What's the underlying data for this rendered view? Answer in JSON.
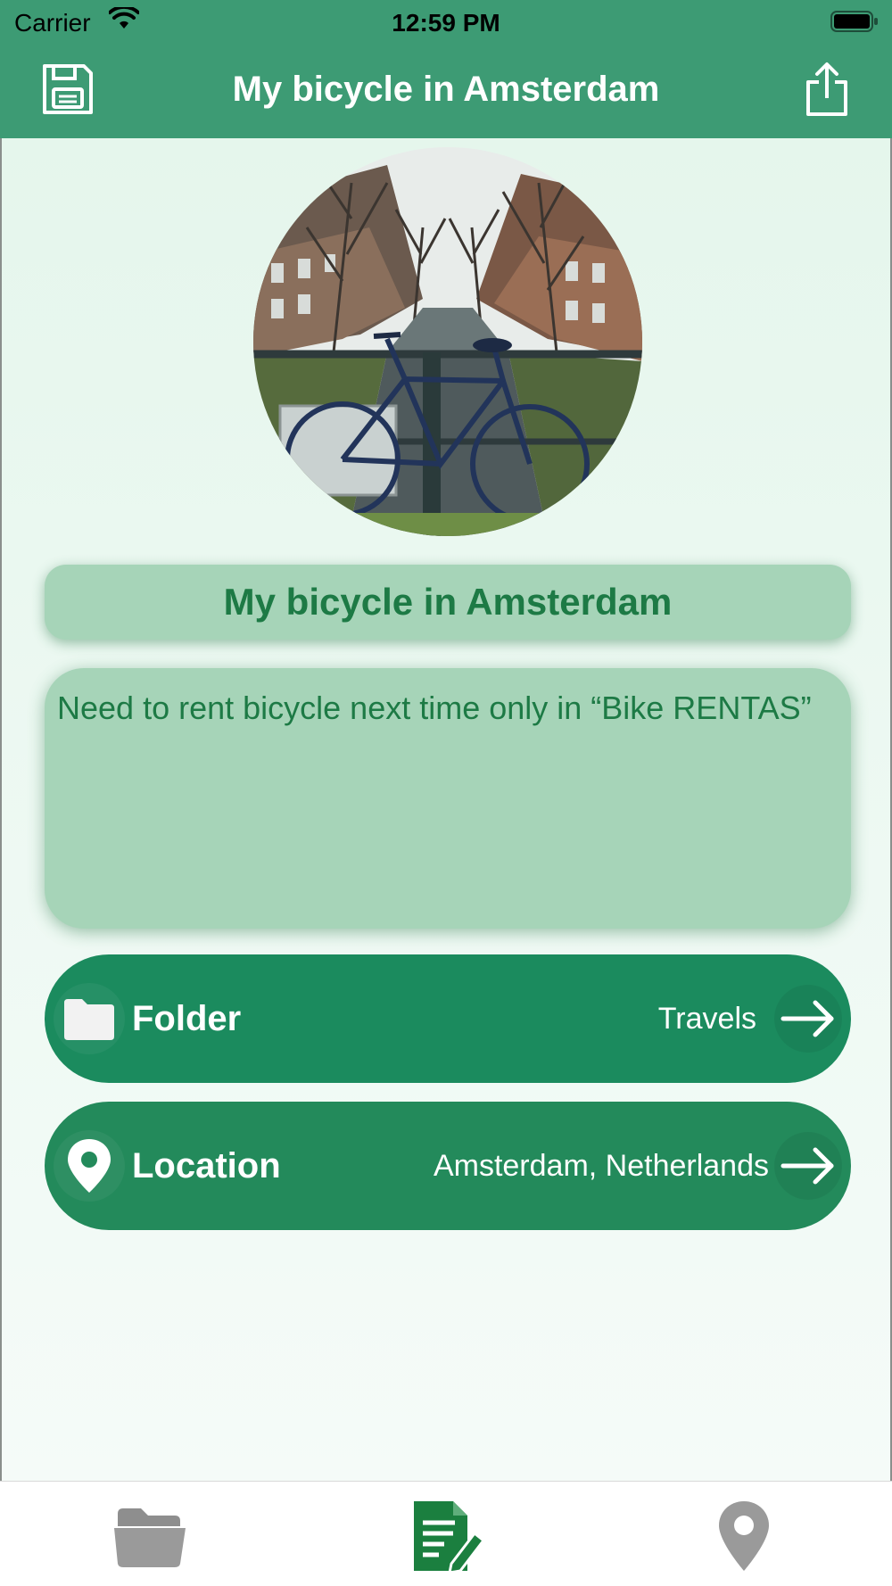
{
  "status_bar": {
    "carrier": "Carrier",
    "time": "12:59 PM"
  },
  "nav": {
    "title": "My bicycle in Amsterdam",
    "left_icon": "save-icon",
    "right_icon": "share-icon"
  },
  "note": {
    "title": "My bicycle in Amsterdam",
    "body": "Need to rent bicycle next time only in “Bike RENTAS”"
  },
  "folder_row": {
    "label": "Folder",
    "value": "Travels",
    "icon": "folder-icon"
  },
  "location_row": {
    "label": "Location",
    "value": "Amsterdam, Netherlands",
    "icon": "location-pin-icon"
  },
  "tab_bar": {
    "tabs": [
      {
        "icon": "folder-icon",
        "active": false
      },
      {
        "icon": "note-edit-icon",
        "active": true
      },
      {
        "icon": "location-pin-icon",
        "active": false
      }
    ]
  },
  "colors": {
    "header": "#3d9b74",
    "row_button": "#1b8b5e",
    "field": "#a6d4b8",
    "field_text": "#1d7a45",
    "tab_active": "#1b7f3f",
    "tab_inactive": "#9a9a9a"
  }
}
